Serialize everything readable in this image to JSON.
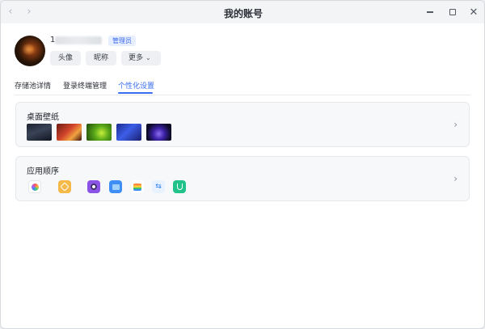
{
  "window": {
    "title": "我的账号"
  },
  "profile": {
    "username": "1",
    "role_badge": "管理员",
    "buttons": {
      "avatar": "头像",
      "nickname": "昵称",
      "more": "更多"
    }
  },
  "tabs": [
    {
      "label": "存储池详情",
      "active": false
    },
    {
      "label": "登录终端管理",
      "active": false
    },
    {
      "label": "个性化设置",
      "active": true
    }
  ],
  "sections": {
    "wallpaper": {
      "title": "桌面壁纸",
      "wallpapers": [
        "wallpaper-dark-mountain",
        "wallpaper-red-abstract",
        "wallpaper-green-leaf",
        "wallpaper-blue-abstract",
        "wallpaper-purple-wave"
      ]
    },
    "app_order": {
      "title": "应用顺序",
      "apps": [
        "photos-icon",
        "notes-icon",
        "music-icon",
        "files-icon",
        "layers-icon",
        "transfer-icon",
        "backup-icon"
      ]
    }
  },
  "icons": {
    "back": "chevron-left-icon",
    "forward": "chevron-right-icon",
    "minimize": "minimize-icon",
    "maximize": "maximize-icon",
    "close": "close-icon"
  },
  "colors": {
    "accent": "#3a6df0",
    "badge_bg": "#e6eeff",
    "card_bg": "#f7f8fa"
  }
}
